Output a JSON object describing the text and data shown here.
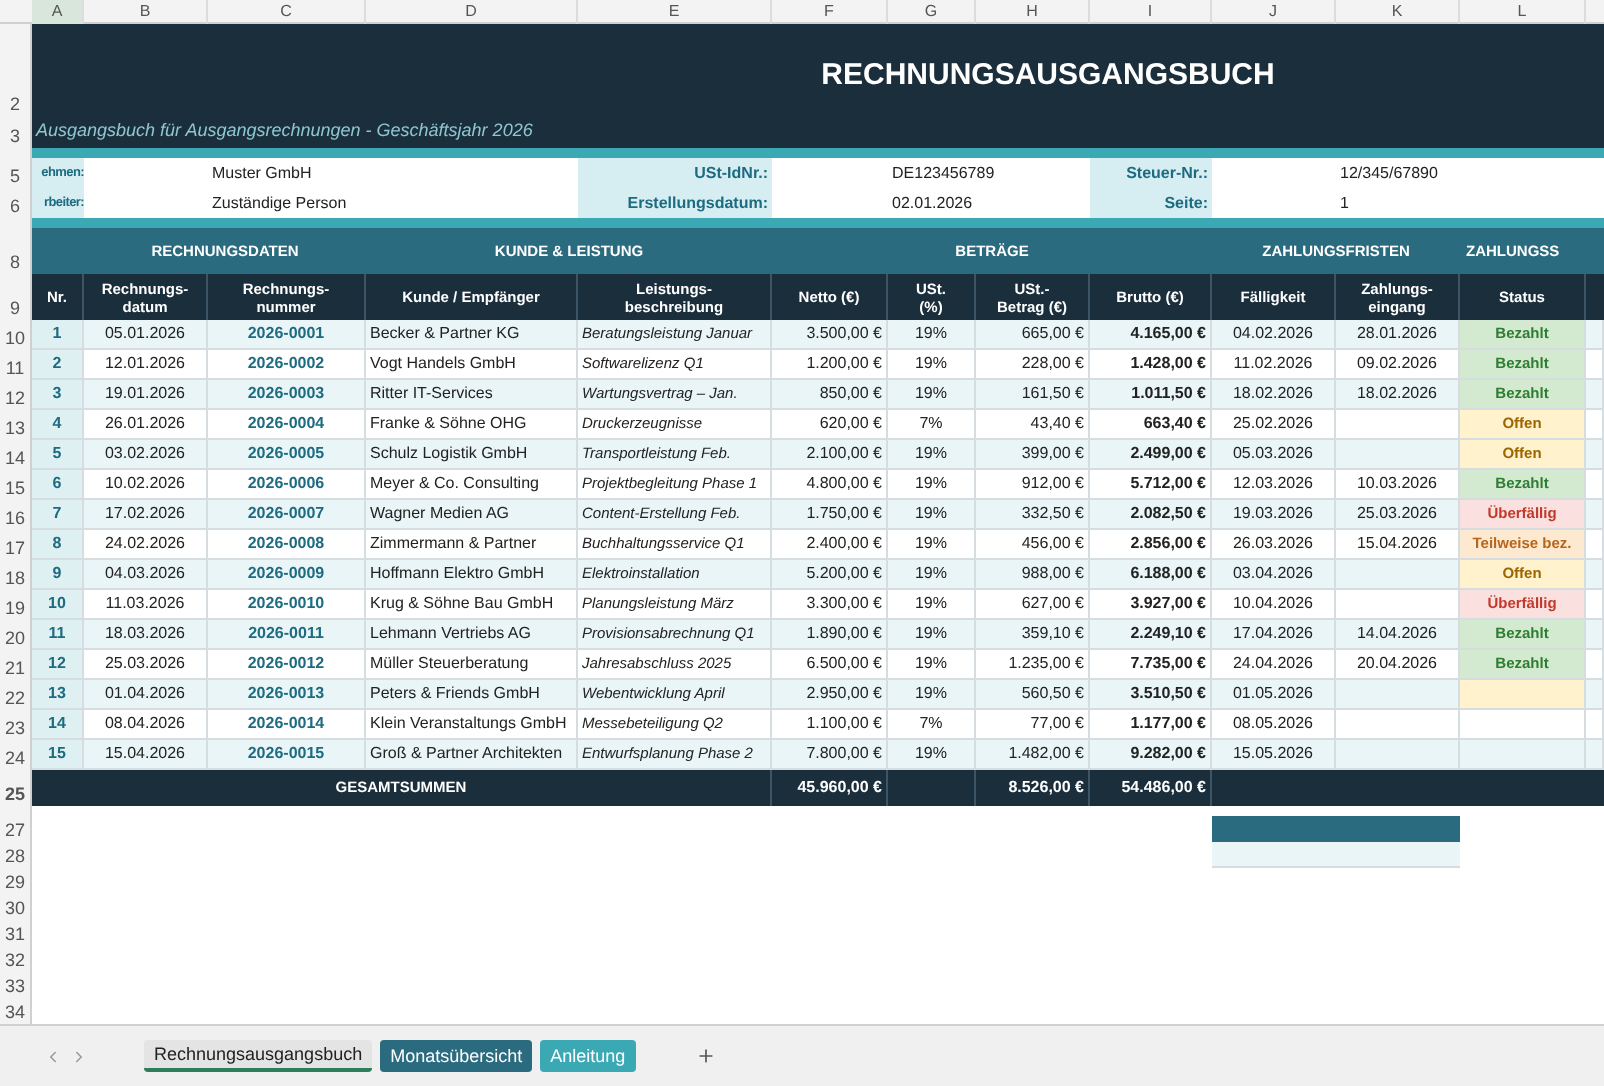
{
  "column_letters": [
    "A",
    "B",
    "C",
    "D",
    "E",
    "F",
    "G",
    "H",
    "I",
    "J",
    "K",
    "L"
  ],
  "title": "RECHNUNGSAUSGANGSBUCH",
  "subtitle": "Ausgangsbuch für Ausgangsrechnungen  -  Geschäftsjahr 2026",
  "info_rows": [
    {
      "label_1": "ehmen:",
      "value_1": "Muster GmbH",
      "label_2": "USt-IdNr.:",
      "value_2": "DE123456789",
      "label_3": "Steuer-Nr.:",
      "value_3": "12/345/67890"
    },
    {
      "label_1": "rbeiter:",
      "value_1": "Zuständige Person",
      "label_2": "Erstellungsdatum:",
      "value_2": "02.01.2026",
      "label_3": "Seite:",
      "value_3": "1"
    }
  ],
  "group_headers": [
    "RECHNUNGSDATEN",
    "KUNDE & LEISTUNG",
    "BETRÄGE",
    "ZAHLUNGSFRISTEN",
    "ZAHLUNGSS"
  ],
  "column_headers": [
    "Nr.",
    "Rechnungs-\ndatum",
    "Rechnungs-\nnummer",
    "Kunde / Empfänger",
    "Leistungs-\nbeschreibung",
    "Netto (€)",
    "USt.\n(%)",
    "USt.-\nBetrag (€)",
    "Brutto (€)",
    "Fälligkeit",
    "Zahlungs-\neingang",
    "Status"
  ],
  "row_numbers": [
    "2",
    "3",
    "5",
    "6",
    "8",
    "9",
    "10",
    "11",
    "12",
    "13",
    "14",
    "15",
    "16",
    "17",
    "18",
    "19",
    "20",
    "21",
    "22",
    "23",
    "24",
    "25",
    "27",
    "28",
    "29",
    "30",
    "31",
    "32",
    "33",
    "34"
  ],
  "rows": [
    {
      "nr": "1",
      "date": "05.01.2026",
      "number": "2026-0001",
      "customer": "Becker & Partner KG",
      "description": "Beratungsleistung Januar",
      "net": "3.500,00 €",
      "vat_rate": "19%",
      "vat": "665,00 €",
      "gross": "4.165,00 €",
      "due": "04.02.2026",
      "paid_on": "28.01.2026",
      "status": {
        "kind": "paid",
        "label": "Bezahlt"
      }
    },
    {
      "nr": "2",
      "date": "12.01.2026",
      "number": "2026-0002",
      "customer": "Vogt Handels GmbH",
      "description": "Softwarelizenz Q1",
      "net": "1.200,00 €",
      "vat_rate": "19%",
      "vat": "228,00 €",
      "gross": "1.428,00 €",
      "due": "11.02.2026",
      "paid_on": "09.02.2026",
      "status": {
        "kind": "paid",
        "label": "Bezahlt"
      }
    },
    {
      "nr": "3",
      "date": "19.01.2026",
      "number": "2026-0003",
      "customer": "Ritter IT-Services",
      "description": "Wartungsvertrag – Jan.",
      "net": "850,00 €",
      "vat_rate": "19%",
      "vat": "161,50 €",
      "gross": "1.011,50 €",
      "due": "18.02.2026",
      "paid_on": "18.02.2026",
      "status": {
        "kind": "paid",
        "label": "Bezahlt"
      }
    },
    {
      "nr": "4",
      "date": "26.01.2026",
      "number": "2026-0004",
      "customer": "Franke & Söhne OHG",
      "description": "Druckerzeugnisse",
      "net": "620,00 €",
      "vat_rate": "7%",
      "vat": "43,40 €",
      "gross": "663,40 €",
      "due": "25.02.2026",
      "status": {
        "kind": "open",
        "label": "Offen"
      }
    },
    {
      "nr": "5",
      "date": "03.02.2026",
      "number": "2026-0005",
      "customer": "Schulz Logistik GmbH",
      "description": "Transportleistung Feb.",
      "net": "2.100,00 €",
      "vat_rate": "19%",
      "vat": "399,00 €",
      "gross": "2.499,00 €",
      "due": "05.03.2026",
      "status": {
        "kind": "open",
        "label": "Offen"
      }
    },
    {
      "nr": "6",
      "date": "10.02.2026",
      "number": "2026-0006",
      "customer": "Meyer & Co. Consulting",
      "description": "Projektbegleitung Phase 1",
      "net": "4.800,00 €",
      "vat_rate": "19%",
      "vat": "912,00 €",
      "gross": "5.712,00 €",
      "due": "12.03.2026",
      "paid_on": "10.03.2026",
      "status": {
        "kind": "paid",
        "label": "Bezahlt"
      }
    },
    {
      "nr": "7",
      "date": "17.02.2026",
      "number": "2026-0007",
      "customer": "Wagner Medien AG",
      "description": "Content-Erstellung Feb.",
      "net": "1.750,00 €",
      "vat_rate": "19%",
      "vat": "332,50 €",
      "gross": "2.082,50 €",
      "due": "19.03.2026",
      "paid_on": "25.03.2026",
      "status": {
        "kind": "overdue",
        "label": "Überfällig"
      }
    },
    {
      "nr": "8",
      "date": "24.02.2026",
      "number": "2026-0008",
      "customer": "Zimmermann & Partner",
      "description": "Buchhaltungsservice Q1",
      "net": "2.400,00 €",
      "vat_rate": "19%",
      "vat": "456,00 €",
      "gross": "2.856,00 €",
      "due": "26.03.2026",
      "paid_on": "15.04.2026",
      "status": {
        "kind": "partial",
        "label": "Teilweise bez."
      }
    },
    {
      "nr": "9",
      "date": "04.03.2026",
      "number": "2026-0009",
      "customer": "Hoffmann Elektro GmbH",
      "description": "Elektroinstallation",
      "net": "5.200,00 €",
      "vat_rate": "19%",
      "vat": "988,00 €",
      "gross": "6.188,00 €",
      "due": "03.04.2026",
      "status": {
        "kind": "open",
        "label": "Offen"
      }
    },
    {
      "nr": "10",
      "date": "11.03.2026",
      "number": "2026-0010",
      "customer": "Krug & Söhne Bau GmbH",
      "description": "Planungsleistung März",
      "net": "3.300,00 €",
      "vat_rate": "19%",
      "vat": "627,00 €",
      "gross": "3.927,00 €",
      "due": "10.04.2026",
      "status": {
        "kind": "overdue",
        "label": "Überfällig"
      }
    },
    {
      "nr": "11",
      "date": "18.03.2026",
      "number": "2026-0011",
      "customer": "Lehmann Vertriebs AG",
      "description": "Provisionsabrechnung Q1",
      "net": "1.890,00 €",
      "vat_rate": "19%",
      "vat": "359,10 €",
      "gross": "2.249,10 €",
      "due": "17.04.2026",
      "paid_on": "14.04.2026",
      "status": {
        "kind": "paid",
        "label": "Bezahlt"
      }
    },
    {
      "nr": "12",
      "date": "25.03.2026",
      "number": "2026-0012",
      "customer": "Müller Steuerberatung",
      "description": "Jahresabschluss 2025",
      "net": "6.500,00 €",
      "vat_rate": "19%",
      "vat": "1.235,00 €",
      "gross": "7.735,00 €",
      "due": "24.04.2026",
      "paid_on": "20.04.2026",
      "status": {
        "kind": "paid",
        "label": "Bezahlt"
      }
    },
    {
      "nr": "13",
      "date": "01.04.2026",
      "number": "2026-0013",
      "customer": "Peters & Friends GmbH",
      "description": "Webentwicklung April",
      "net": "2.950,00 €",
      "vat_rate": "19%",
      "vat": "560,50 €",
      "gross": "3.510,50 €",
      "due": "01.05.2026",
      "status": {
        "kind": "open"
      }
    },
    {
      "nr": "14",
      "date": "08.04.2026",
      "number": "2026-0014",
      "customer": "Klein Veranstaltungs GmbH",
      "description": "Messebeteiligung Q2",
      "net": "1.100,00 €",
      "vat_rate": "7%",
      "vat": "77,00 €",
      "gross": "1.177,00 €",
      "due": "08.05.2026"
    },
    {
      "nr": "15",
      "date": "15.04.2026",
      "number": "2026-0015",
      "customer": "Groß & Partner Architekten",
      "description": "Entwurfsplanung Phase 2",
      "net": "7.800,00 €",
      "vat_rate": "19%",
      "vat": "1.482,00 €",
      "gross": "9.282,00 €",
      "due": "15.05.2026"
    }
  ],
  "totals": {
    "label": "GESAMTSUMMEN",
    "net": "45.960,00 €",
    "vat": "8.526,00 €",
    "gross": "54.486,00 €"
  },
  "sheet_tabs": [
    {
      "label": "Rechnungsausgangsbuch",
      "selected": true,
      "color": "#2e7d5b"
    },
    {
      "label": "Monatsübersicht",
      "selected": false,
      "color": "#2b6b7f"
    },
    {
      "label": "Anleitung",
      "selected": false,
      "color": "#3aa9b3"
    }
  ]
}
